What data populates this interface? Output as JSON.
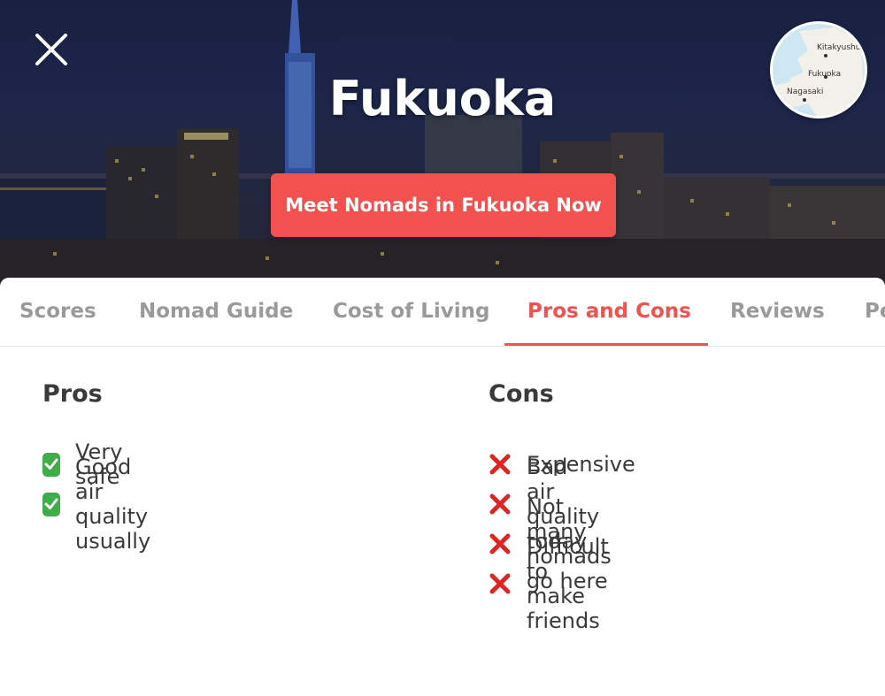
{
  "city": {
    "name": "Fukuoka"
  },
  "cta": {
    "label": "Meet Nomads in Fukuoka Now"
  },
  "map": {
    "labels": [
      "Kitakyushu",
      "Fukuoka",
      "Nagasaki"
    ]
  },
  "tabs": [
    {
      "label": "Scores"
    },
    {
      "label": "Nomad Guide"
    },
    {
      "label": "Cost of Living"
    },
    {
      "label": "Pros and Cons"
    },
    {
      "label": "Reviews"
    },
    {
      "label": "Pe"
    }
  ],
  "active_tab": "Pros and Cons",
  "pros": {
    "title": "Pros",
    "items": [
      "Very safe",
      "Good air quality usually"
    ]
  },
  "cons": {
    "title": "Cons",
    "items": [
      "Expensive",
      "Bad air quality today",
      "Not many nomads go here",
      "Difficult to make friends"
    ]
  },
  "colors": {
    "accent": "#f2514f",
    "check": "#3fae49",
    "cross": "#e02424",
    "tab_inactive": "#9a9a9a",
    "text": "#3a3a3a"
  },
  "icons": {
    "close": "close-icon",
    "pro": "check-mark-icon",
    "con": "cross-mark-icon"
  }
}
